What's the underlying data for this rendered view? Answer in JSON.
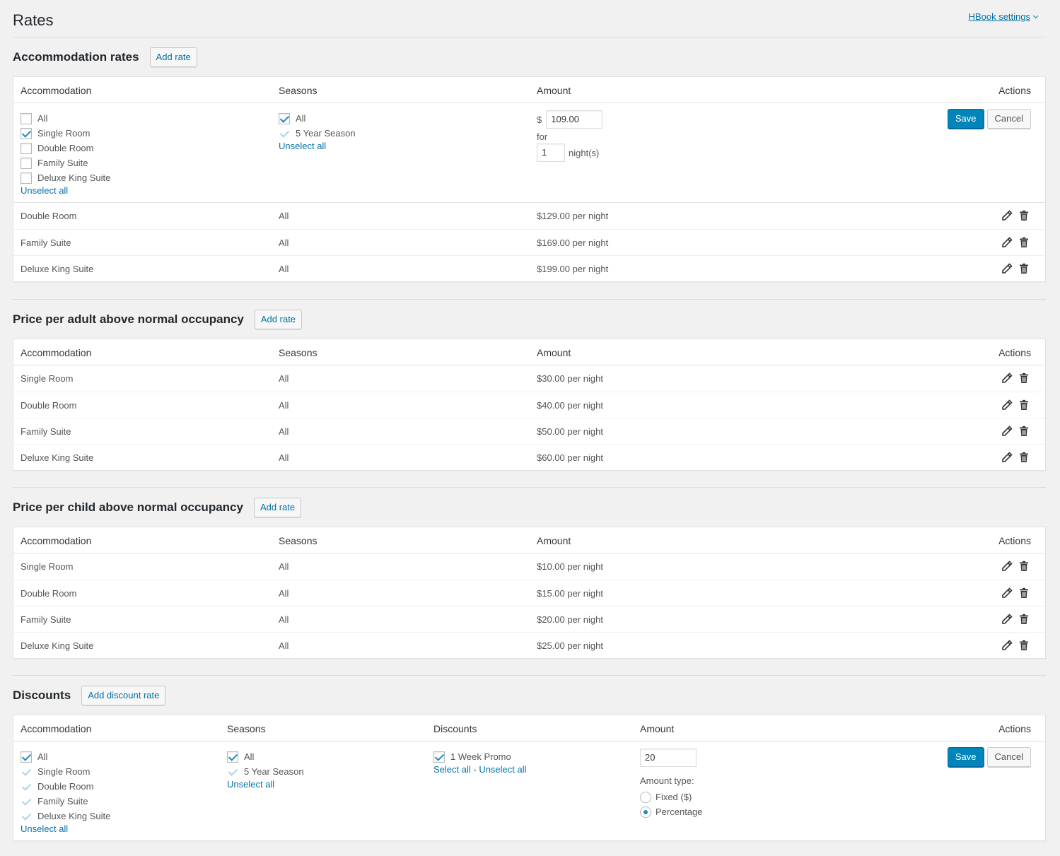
{
  "page": {
    "title": "Rates",
    "settings_link": "HBook settings"
  },
  "columns": {
    "accommodation": "Accommodation",
    "seasons": "Seasons",
    "amount": "Amount",
    "actions": "Actions",
    "discounts": "Discounts"
  },
  "common": {
    "add_rate": "Add rate",
    "save": "Save",
    "cancel": "Cancel",
    "unselect_all": "Unselect all",
    "select_all": "Select all",
    "link_sep": " - "
  },
  "accommodation_rates": {
    "title": "Accommodation rates",
    "edit": {
      "accommodations": [
        {
          "label": "All",
          "checked": false
        },
        {
          "label": "Single Room",
          "checked": true
        },
        {
          "label": "Double Room",
          "checked": false
        },
        {
          "label": "Family Suite",
          "checked": false
        },
        {
          "label": "Deluxe King Suite",
          "checked": false
        }
      ],
      "seasons": [
        {
          "label": "All",
          "checked": true
        },
        {
          "label": "5 Year Season",
          "checked": true
        }
      ],
      "currency": "$",
      "amount_value": "109.00",
      "for_label": "for",
      "nights_value": "1",
      "nights_label": "night(s)"
    },
    "rows": [
      {
        "accommodation": "Double Room",
        "seasons": "All",
        "amount": "$129.00 per night"
      },
      {
        "accommodation": "Family Suite",
        "seasons": "All",
        "amount": "$169.00 per night"
      },
      {
        "accommodation": "Deluxe King Suite",
        "seasons": "All",
        "amount": "$199.00 per night"
      }
    ]
  },
  "adult_rates": {
    "title": "Price per adult above normal occupancy",
    "rows": [
      {
        "accommodation": "Single Room",
        "seasons": "All",
        "amount": "$30.00 per night"
      },
      {
        "accommodation": "Double Room",
        "seasons": "All",
        "amount": "$40.00 per night"
      },
      {
        "accommodation": "Family Suite",
        "seasons": "All",
        "amount": "$50.00 per night"
      },
      {
        "accommodation": "Deluxe King Suite",
        "seasons": "All",
        "amount": "$60.00 per night"
      }
    ]
  },
  "child_rates": {
    "title": "Price per child above normal occupancy",
    "rows": [
      {
        "accommodation": "Single Room",
        "seasons": "All",
        "amount": "$10.00 per night"
      },
      {
        "accommodation": "Double Room",
        "seasons": "All",
        "amount": "$15.00 per night"
      },
      {
        "accommodation": "Family Suite",
        "seasons": "All",
        "amount": "$20.00 per night"
      },
      {
        "accommodation": "Deluxe King Suite",
        "seasons": "All",
        "amount": "$25.00 per night"
      }
    ]
  },
  "discounts": {
    "title": "Discounts",
    "add_label": "Add discount rate",
    "edit": {
      "accommodations": [
        {
          "label": "All",
          "checked": true
        },
        {
          "label": "Single Room",
          "checked": true
        },
        {
          "label": "Double Room",
          "checked": true
        },
        {
          "label": "Family Suite",
          "checked": true
        },
        {
          "label": "Deluxe King Suite",
          "checked": true
        }
      ],
      "seasons": [
        {
          "label": "All",
          "checked": true
        },
        {
          "label": "5 Year Season",
          "checked": true
        }
      ],
      "discount_items": [
        {
          "label": "1 Week Promo",
          "checked": true
        }
      ],
      "amount_value": "20",
      "amount_type_label": "Amount type:",
      "amount_types": [
        {
          "label": "Fixed ($)",
          "checked": false
        },
        {
          "label": "Percentage",
          "checked": true
        }
      ]
    }
  },
  "icons": {
    "edit": "pencil-icon",
    "delete": "trash-icon"
  },
  "colors": {
    "link": "#0073aa",
    "primary": "#0085ba",
    "background": "#f1f1f1"
  }
}
